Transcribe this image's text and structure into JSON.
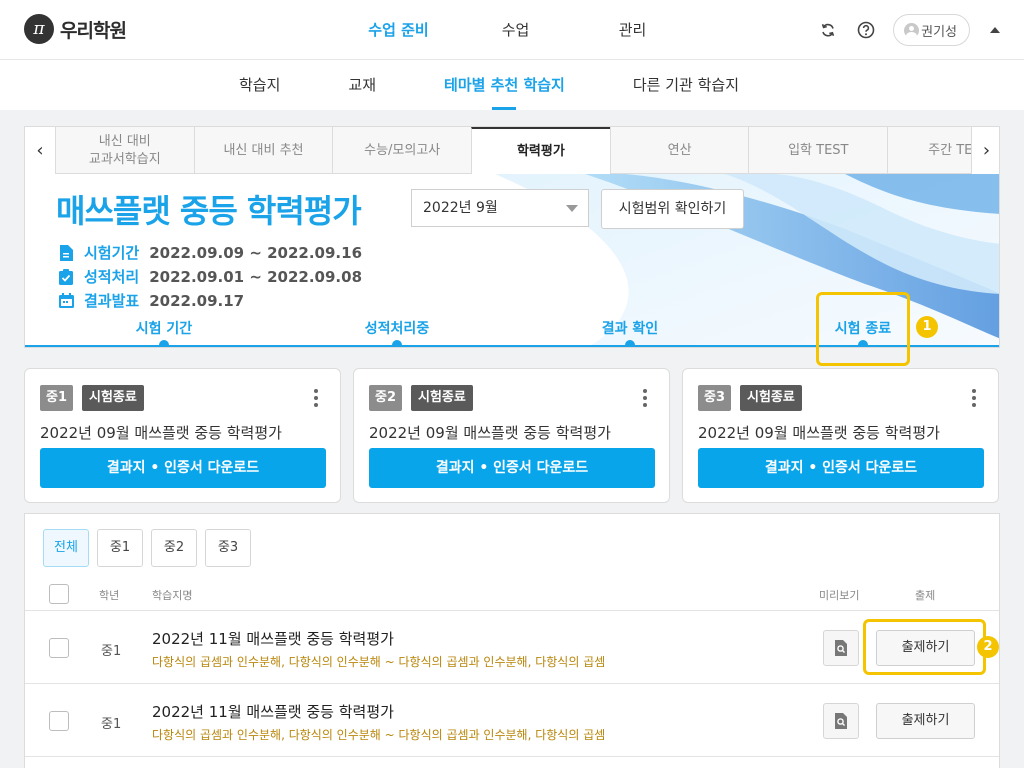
{
  "brand": {
    "logo_glyph": "π",
    "name": "우리학원"
  },
  "main_nav": [
    "수업 준비",
    "수업",
    "관리"
  ],
  "user": {
    "name": "권기성"
  },
  "sub_nav": [
    "학습지",
    "교재",
    "테마별 추천 학습지",
    "다른 기관 학습지"
  ],
  "tabs": [
    "내신 대비\n교과서학습지",
    "내신 대비 추천",
    "수능/모의고사",
    "학력평가",
    "연산",
    "입학 TEST",
    "주간 TE"
  ],
  "banner": {
    "title": "매쓰플랫 중등 학력평가",
    "month": "2022년 9월",
    "range_button": "시험범위 확인하기",
    "exam_period_label": "시험기간",
    "exam_period": "2022.09.09 ~ 2022.09.16",
    "grading_label": "성적처리",
    "grading_period": "2022.09.01 ~ 2022.09.08",
    "result_label": "결과발표",
    "result_date": "2022.09.17",
    "steps": [
      "시험 기간",
      "성적처리중",
      "결과 확인",
      "시험 종료"
    ]
  },
  "annotation_badges": [
    "1",
    "2"
  ],
  "cards": [
    {
      "grade": "중1",
      "status": "시험종료",
      "exam": "2022년 09월 매쓰플랫 중등 학력평가",
      "button": "결과지 • 인증서 다운로드"
    },
    {
      "grade": "중2",
      "status": "시험종료",
      "exam": "2022년 09월 매쓰플랫 중등 학력평가",
      "button": "결과지 • 인증서 다운로드"
    },
    {
      "grade": "중3",
      "status": "시험종료",
      "exam": "2022년 09월 매쓰플랫 중등 학력평가",
      "button": "결과지 • 인증서 다운로드"
    }
  ],
  "filters": [
    "전체",
    "중1",
    "중2",
    "중3"
  ],
  "list_header": {
    "grade": "학년",
    "name": "학습지명",
    "preview": "미리보기",
    "assign": "출제"
  },
  "rows": [
    {
      "grade": "중1",
      "title": "2022년 11월 매쓰플랫 중등 학력평가",
      "scope": "다항식의 곱셈과 인수분해, 다항식의 인수분해 ~ 다항식의 곱셈과 인수분해, 다항식의 곱셈",
      "assign_label": "출제하기"
    },
    {
      "grade": "중1",
      "title": "2022년 11월 매쓰플랫 중등 학력평가",
      "scope": "다항식의 곱셈과 인수분해, 다항식의 인수분해 ~ 다항식의 곱셈과 인수분해, 다항식의 곱셈",
      "assign_label": "출제하기"
    }
  ],
  "colors": {
    "accent": "#1aa3e8",
    "download": "#08a5eb",
    "highlight": "#f5c400",
    "status_badge": "#5a5a5a",
    "grade_badge": "#8c8c8c",
    "scope_text": "#b8860b"
  }
}
